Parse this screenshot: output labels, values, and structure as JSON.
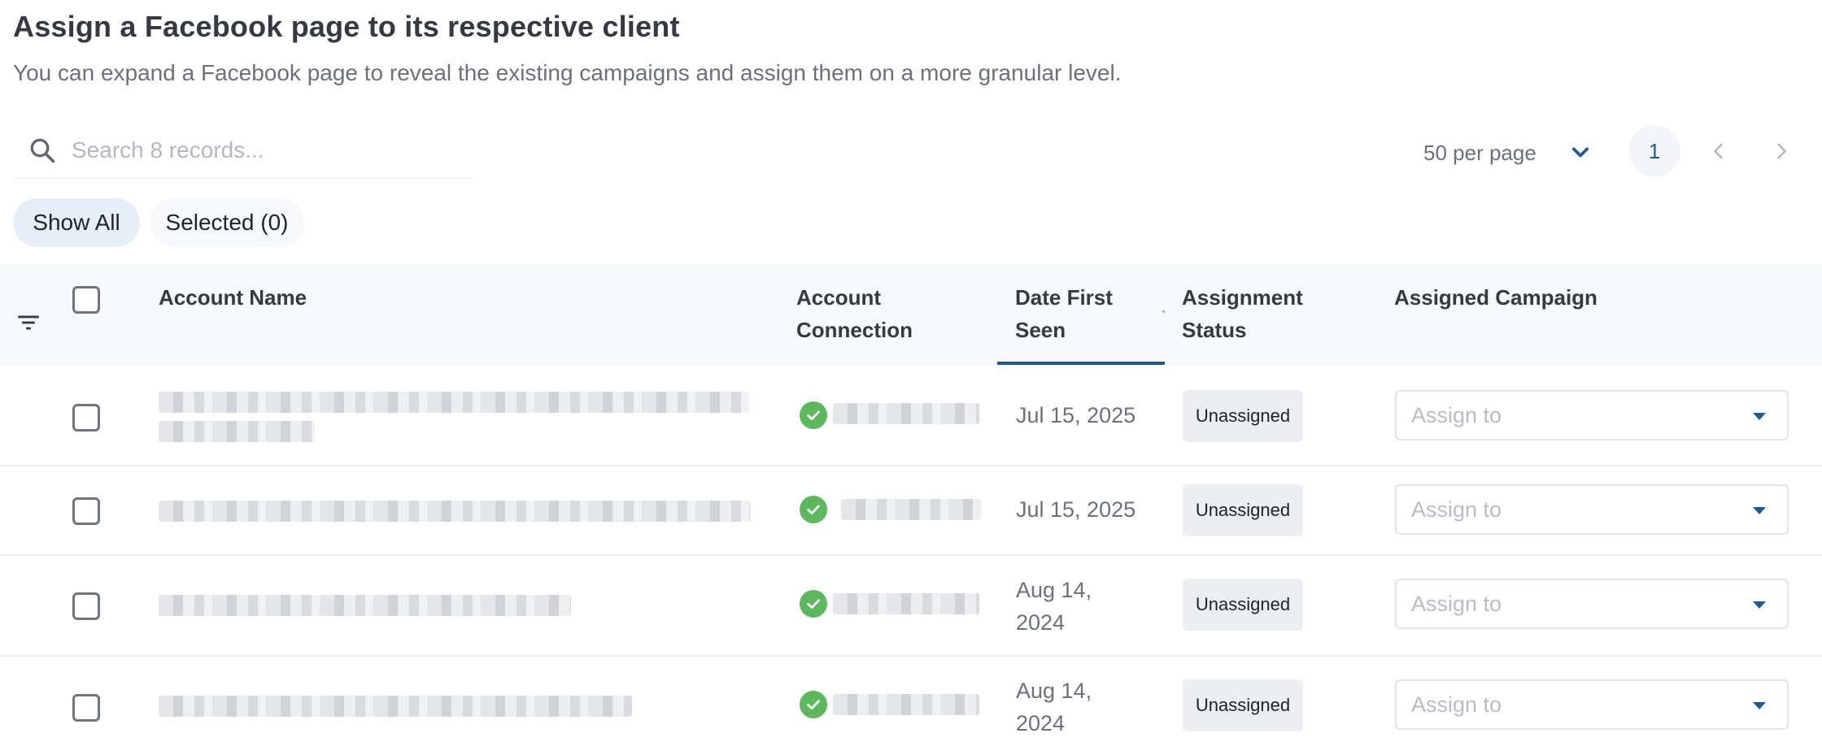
{
  "header": {
    "title": "Assign a Facebook page to its respective client",
    "subtitle": "You can expand a Facebook page to reveal the existing campaigns and assign them on a more granular level."
  },
  "search": {
    "placeholder": "Search 8 records...",
    "value": "",
    "icon": "search-icon"
  },
  "pagination": {
    "per_page_label": "50 per page",
    "current_page": "1"
  },
  "filters": {
    "show_all": "Show All",
    "selected": "Selected (0)"
  },
  "table": {
    "columns": {
      "account_name": "Account Name",
      "account_connection": "Account Connection",
      "date_first_seen": "Date First Seen",
      "assignment_status": "Assignment Status",
      "assigned_campaign": "Assigned Campaign"
    },
    "rows": [
      {
        "date_line1": "Jul 15, 2025",
        "date_line2": "",
        "status": "Unassigned",
        "assign_placeholder": "Assign to"
      },
      {
        "date_line1": "Jul 15, 2025",
        "date_line2": "",
        "status": "Unassigned",
        "assign_placeholder": "Assign to"
      },
      {
        "date_line1": "Aug 14,",
        "date_line2": "2024",
        "status": "Unassigned",
        "assign_placeholder": "Assign to"
      },
      {
        "date_line1": "Aug 14,",
        "date_line2": "2024",
        "status": "Unassigned",
        "assign_placeholder": "Assign to"
      }
    ]
  },
  "colors": {
    "accent": "#1e5a9a",
    "success": "#5cb85c",
    "chip_active": "#e6eef7"
  }
}
